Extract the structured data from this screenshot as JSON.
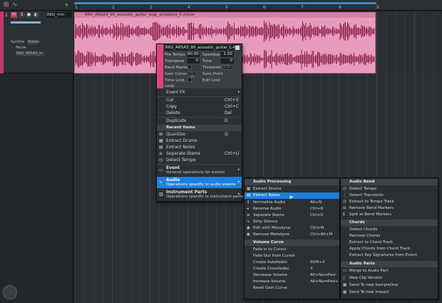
{
  "track": {
    "number": "2",
    "mute": "M",
    "solo": "S",
    "name": "RKU_min",
    "instrument": "Synthe",
    "channel_mode": "Stereo",
    "input": "None",
    "file": "RKU_ARSA3_in 1",
    "color": "#c23a66"
  },
  "ruler": {
    "marks": [
      "1",
      "2",
      "3",
      "4",
      "5",
      "6",
      "7",
      "8",
      "9"
    ]
  },
  "event": {
    "title": "RKU_ARSA3_90_acoustic_guitar_loop_amodone_C.minor",
    "color": "#e79cbf",
    "waveform_color": "#8a1f46"
  },
  "inspector": {
    "name": "RKU_ARSA3_90_acoustic_guitar_L-4min",
    "file_tempo_label": "File Tempo",
    "file_tempo": "90.00",
    "speedup_label": "Speedup",
    "speedup": "1.00",
    "transpose_label": "Transpose",
    "transpose": "0",
    "tune_label": "Tune",
    "tune": "0",
    "bend_marker_label": "Bend Marker",
    "threshold_label": "Threshold",
    "threshold": "0 %",
    "gain_curve_label": "Gain Curve",
    "gain_curve": "-∞ dB",
    "sync_point_label": "Sync Point",
    "time_lock_label": "Time Lock",
    "edit_lock_label": "Edit Lock",
    "loop_label": "Loop"
  },
  "context_menu": {
    "event_fx": "Event FX",
    "cut": "Cut",
    "cut_sc": "Ctrl+X",
    "copy": "Copy",
    "copy_sc": "Ctrl+C",
    "delete": "Delete",
    "delete_sc": "Del",
    "duplicate": "Duplicate",
    "duplicate_sc": "D",
    "recent_header": "Recent items",
    "quantize": "Quantize",
    "quantize_sc": "Q",
    "extract_drums": "Extract Drums",
    "extract_notes": "Extract Notes",
    "separate_stems": "Separate Stems",
    "separate_stems_sc": "Ctrl+U",
    "detect_tempo": "Detect Tempo",
    "event_title": "Event",
    "event_desc": "General operations for events",
    "audio_title": "Audio",
    "audio_desc": "Operations specific to audio events",
    "instr_title": "Instrument Parts",
    "instr_desc": "Operations specific to instrument parts"
  },
  "audio_submenu": {
    "processing_header": "Audio Processing",
    "extract_drums": "Extract Drums",
    "extract_notes": "Extract Notes",
    "normalize": "Normalize Audio",
    "normalize_sc": "Alt+N",
    "reverse": "Reverse Audio",
    "reverse_sc": "Ctrl+R",
    "separate_stems": "Separate Stems",
    "separate_stems_sc": "Ctrl+U",
    "strip_silence": "Strip Silence",
    "edit_melodyne": "Edit with Melodyne",
    "edit_melodyne_sc": "Ctrl+M",
    "remove_melodyne": "Remove Melodyne",
    "remove_melodyne_sc": "Ctrl+Alt+M",
    "volume_header": "Volume Curve",
    "fade_in": "Fade in to Cursor",
    "fade_out": "Fade Out from Cursor",
    "create_autofades": "Create Autofades",
    "create_autofades_sc": "Shift+X",
    "create_crossfades": "Create Crossfades",
    "create_crossfades_sc": "X",
    "decrease_volume": "Decrease Volume",
    "decrease_volume_sc": "Alt+NumPad-",
    "increase_volume": "Increase Volume",
    "increase_volume_sc": "Alt+NumPad+",
    "reset_gain": "Reset Gain Curve"
  },
  "bend_submenu": {
    "bend_header": "Audio Bend",
    "detect_tempo": "Detect Tempo",
    "detect_transients": "Detect Transients",
    "extract_tempo_track": "Extract to Tempo Track",
    "remove_bend": "Remove Bend Markers",
    "split_bend": "Split at Bend Markers",
    "chords_header": "Chords",
    "detect_chords": "Detect Chords",
    "remove_chords": "Remove Chords",
    "extract_chord_track": "Extract to Chord Track",
    "apply_chords": "Apply Chords from Chord Track",
    "extract_key": "Extract Key Signatures from Event",
    "parts_header": "Audio Parts",
    "merge_part": "Merge to Audio Part",
    "new_clip": "New Clip Version",
    "send_sampleone": "Send To new SampleOne",
    "send_impact": "Send To new Impact"
  }
}
